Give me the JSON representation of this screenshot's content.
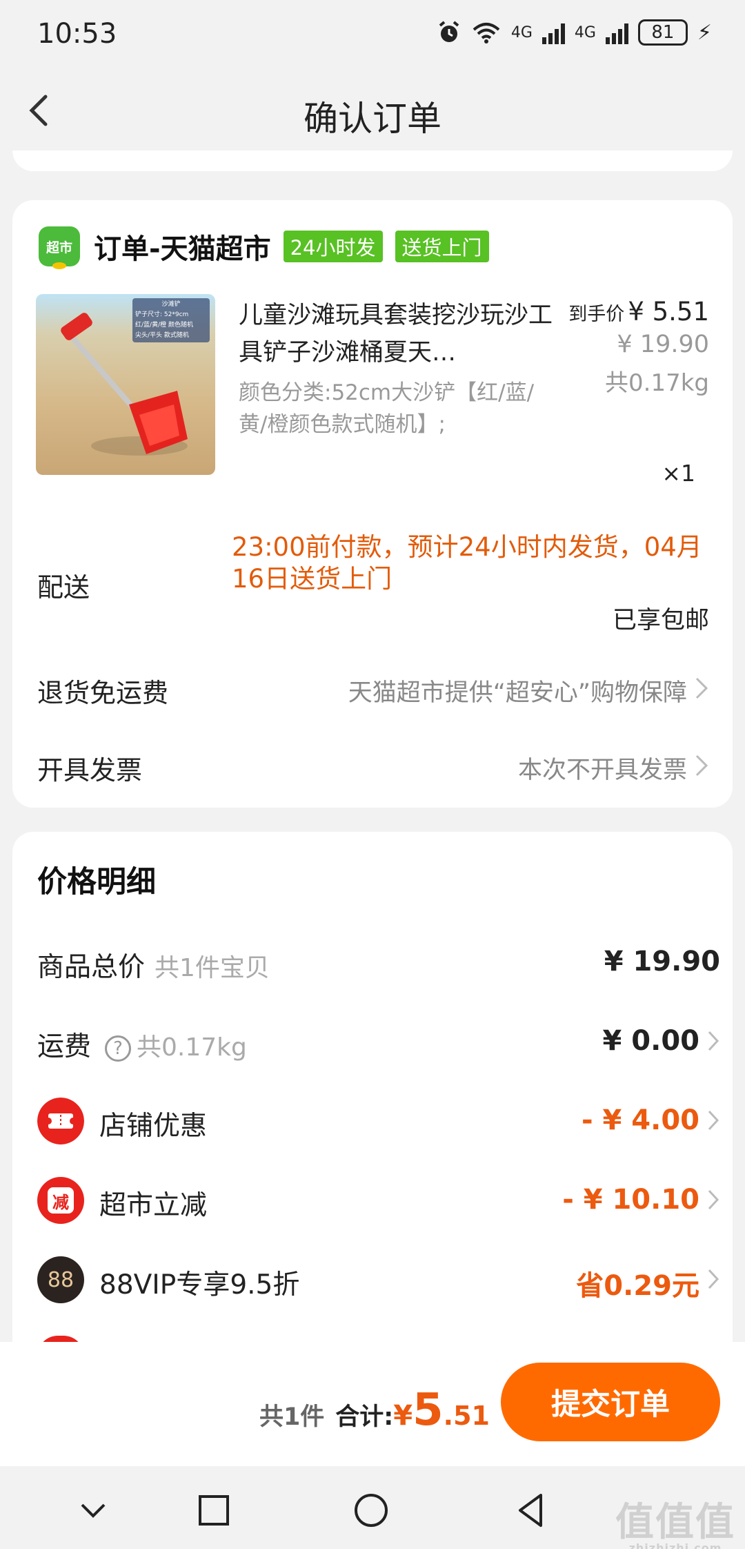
{
  "status_bar": {
    "time": "10:53",
    "battery": "81",
    "net1": "4G",
    "net2": "4G"
  },
  "nav": {
    "title": "确认订单"
  },
  "order": {
    "store_logo_text": "超市",
    "store_name": "订单-天猫超市",
    "tags": [
      "24小时发",
      "送货上门"
    ],
    "product": {
      "title": "儿童沙滩玩具套装挖沙玩沙工具铲子沙滩桶夏天…",
      "sku": "颜色分类:52cm大沙铲【红/蓝/黄/橙颜色款式随机】;",
      "final_price_label": "到手价",
      "final_price": "¥ 5.51",
      "original_price": "¥ 19.90",
      "weight": "共0.17kg",
      "quantity": "×1",
      "image_labels": [
        "沙滩铲",
        "铲子尺寸: 52*9cm",
        "红/蓝/黄/橙 颜色随机",
        "尖头/平头 款式随机"
      ]
    },
    "shipping": {
      "label": "配送",
      "info": "23:00前付款，预计24小时内发货，04月16日送货上门",
      "free": "已享包邮"
    },
    "returns": {
      "label": "退货免运费",
      "value": "天猫超市提供“超安心”购物保障"
    },
    "invoice": {
      "label": "开具发票",
      "value": "本次不开具发票"
    }
  },
  "price_detail": {
    "title": "价格明细",
    "rows": [
      {
        "label": "商品总价",
        "sub": "共1件宝贝",
        "amount": "¥ 19.90"
      },
      {
        "label": "运费",
        "help": "?",
        "sub": "共0.17kg",
        "amount": "¥ 0.00"
      },
      {
        "label": "店铺优惠",
        "amount": "- ¥ 4.00",
        "icon": "ticket-icon"
      },
      {
        "label": "超市立减",
        "amount": "- ¥ 10.10",
        "icon": "discount-icon",
        "icon_text": "减"
      },
      {
        "label": "88VIP专享9.5折",
        "amount": "省0.29元",
        "icon": "vip-88-icon",
        "icon_text": "88"
      }
    ]
  },
  "bottom": {
    "count": "共1件",
    "total_label": "合计:",
    "currency": "¥",
    "total_int": "5",
    "total_dec": ".51",
    "submit": "提交订单"
  },
  "watermark": {
    "text": "值值值",
    "url": "zhizhizhi.com"
  },
  "colors": {
    "accent": "#ff6a00",
    "price_red": "#ec5a0f",
    "tag_green": "#58c124"
  }
}
